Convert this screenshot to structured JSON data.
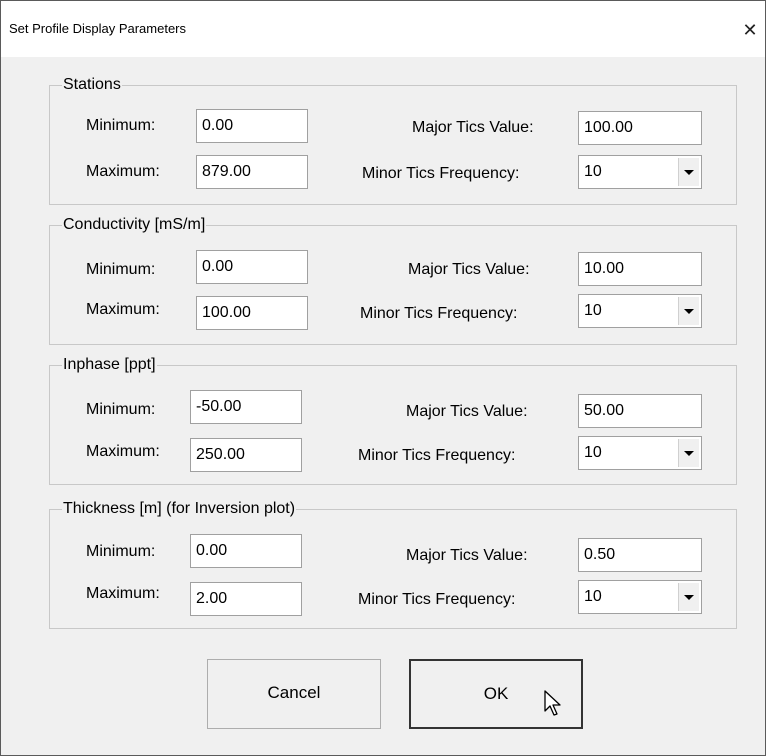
{
  "window": {
    "title": "Set Profile Display Parameters",
    "close_glyph": "✕"
  },
  "labels": {
    "minimum": "Minimum:",
    "maximum": "Maximum:",
    "major_tics": "Major Tics Value:",
    "minor_tics": "Minor Tics Frequency:"
  },
  "groups": [
    {
      "title": "Stations",
      "minimum": "0.00",
      "maximum": "879.00",
      "major_tics": "100.00",
      "minor_tics": "10"
    },
    {
      "title": "Conductivity [mS/m]",
      "minimum": "0.00",
      "maximum": "100.00",
      "major_tics": "10.00",
      "minor_tics": "10"
    },
    {
      "title": "Inphase [ppt]",
      "minimum": "-50.00",
      "maximum": "250.00",
      "major_tics": "50.00",
      "minor_tics": "10"
    },
    {
      "title": "Thickness [m] (for Inversion plot)",
      "minimum": "0.00",
      "maximum": "2.00",
      "major_tics": "0.50",
      "minor_tics": "10"
    }
  ],
  "buttons": {
    "cancel": "Cancel",
    "ok": "OK"
  }
}
